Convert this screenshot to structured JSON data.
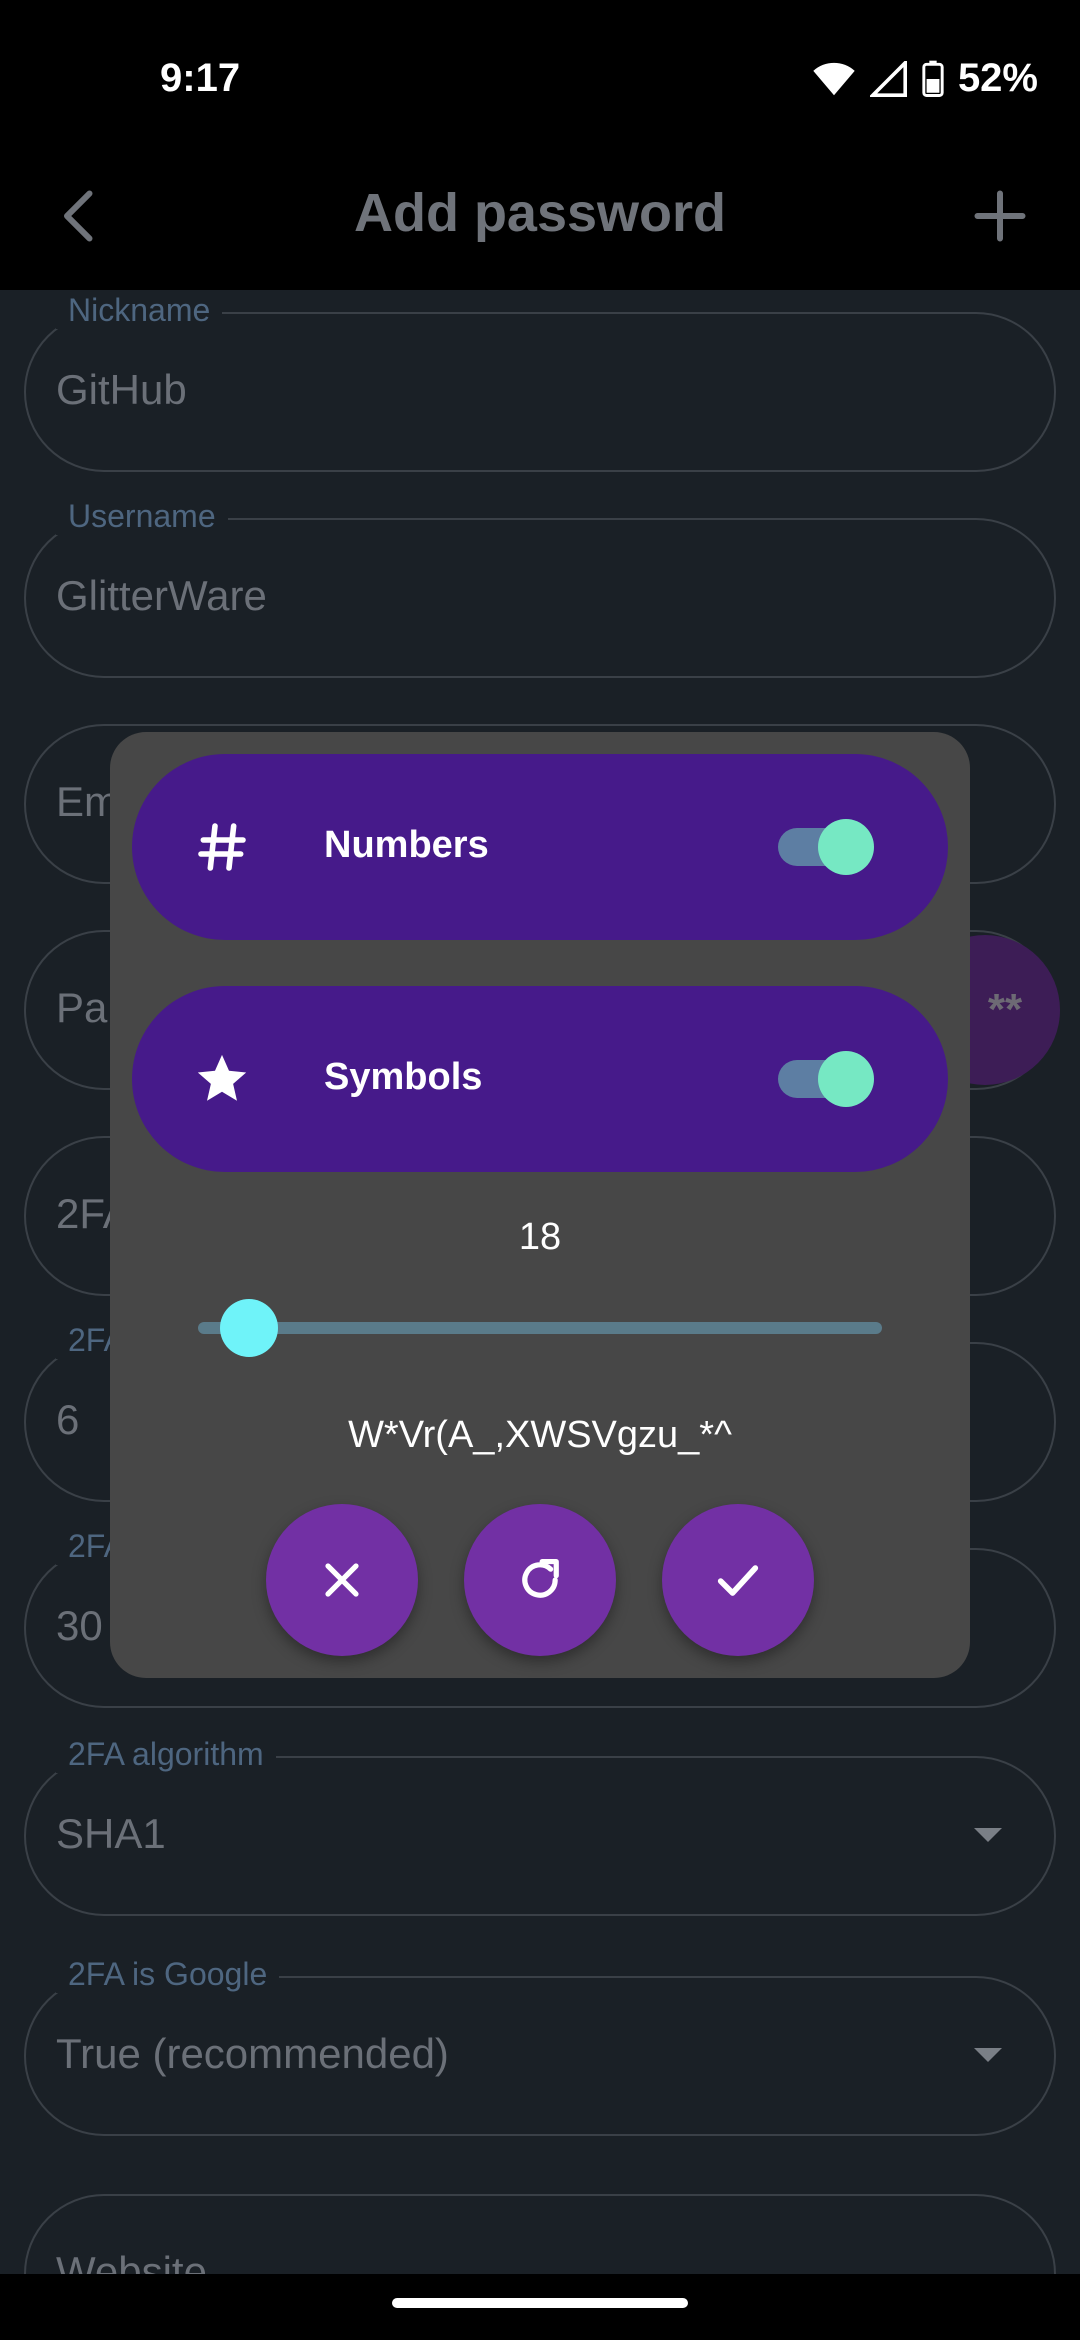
{
  "status_bar": {
    "time": "9:17",
    "battery": "52%"
  },
  "app_bar": {
    "title": "Add password"
  },
  "form": {
    "nickname": {
      "label": "Nickname",
      "value": "GitHub"
    },
    "username": {
      "label": "Username",
      "value": "GlitterWare"
    },
    "email": {
      "value": "Em"
    },
    "password": {
      "value": "Pa"
    },
    "twofa_secret": {
      "value": "2FA"
    },
    "twofa_digits": {
      "label": "2FA",
      "value": "6"
    },
    "twofa_period": {
      "label": "2FA",
      "value": "30"
    },
    "twofa_algorithm": {
      "label": "2FA algorithm",
      "value": "SHA1"
    },
    "twofa_google": {
      "label": "2FA is Google",
      "value": "True (recommended)"
    },
    "website": {
      "value": "Website"
    }
  },
  "generator_button": {
    "label": "**"
  },
  "dialog": {
    "numbers": {
      "label": "Numbers",
      "enabled": true
    },
    "symbols": {
      "label": "Symbols",
      "enabled": true
    },
    "length": "18",
    "generated_password": "W*Vr(A_,XWSVgzu_*^"
  },
  "colors": {
    "accent": "#7230a4",
    "toggle_card": "#461a8a",
    "switch_thumb": "#76e8c3",
    "slider_thumb": "#6ff3f9"
  },
  "icons": [
    "back-arrow-icon",
    "add-icon",
    "hash-icon",
    "star-icon",
    "close-icon",
    "refresh-icon",
    "check-icon"
  ]
}
